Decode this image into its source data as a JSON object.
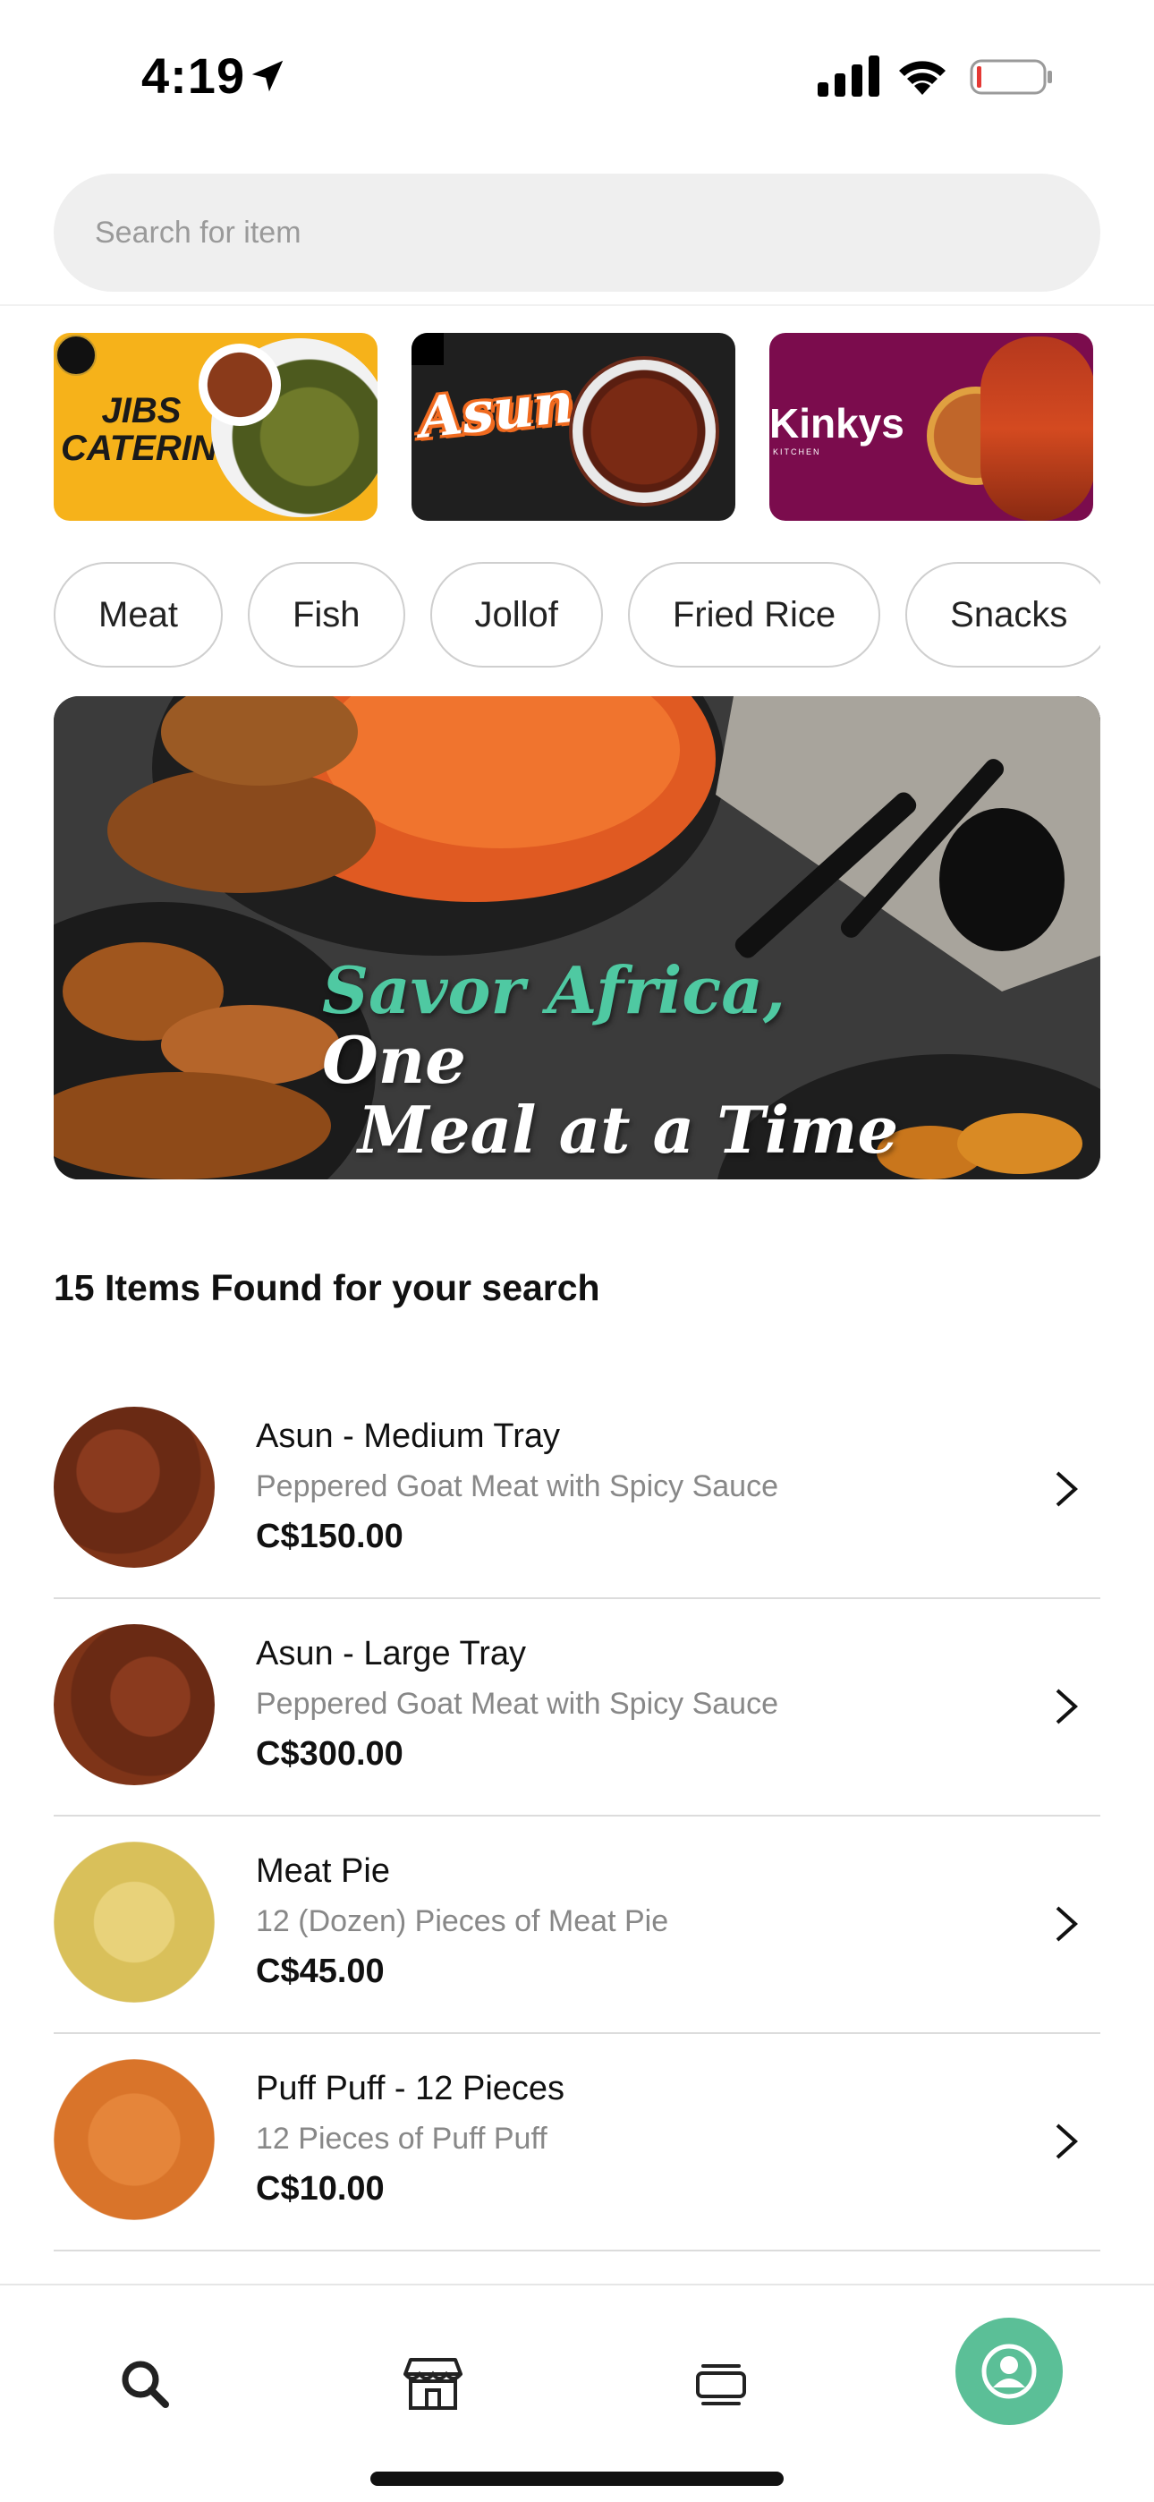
{
  "status_bar": {
    "time": "4:19"
  },
  "search": {
    "placeholder": "Search for item"
  },
  "vendors": [
    {
      "name": "JIBS CATERING",
      "icon": "vendor-jibs"
    },
    {
      "name": "Asun yyc",
      "icon": "vendor-asun"
    },
    {
      "name": "Kinkys",
      "subtitle": "KITCHEN",
      "icon": "vendor-kinkys"
    }
  ],
  "categories": [
    "Meat",
    "Fish",
    "Jollof",
    "Fried Rice",
    "Snacks"
  ],
  "hero": {
    "slogan_accent": "Savor Africa,",
    "slogan_rest": "One",
    "slogan_line2": "Meal at a Time"
  },
  "results": {
    "title": "15 Items Found for your search"
  },
  "items": [
    {
      "name": "Asun - Medium Tray",
      "description": "Peppered Goat Meat with Spicy Sauce",
      "price": "C$150.00"
    },
    {
      "name": "Asun - Large Tray",
      "description": "Peppered Goat Meat with Spicy Sauce",
      "price": "C$300.00"
    },
    {
      "name": "Meat Pie",
      "description": "12 (Dozen) Pieces of Meat Pie",
      "price": "C$45.00"
    },
    {
      "name": "Puff Puff - 12 Pieces",
      "description": "12 Pieces of Puff Puff",
      "price": "C$10.00"
    }
  ],
  "nav": {
    "items": [
      "search-icon",
      "store-icon",
      "orders-icon",
      "profile-icon"
    ],
    "active_color": "#5bbf97"
  },
  "colors": {
    "accent": "#4fc9a2",
    "jibs_bg": "#f6b21a",
    "asun_bg": "#1f1f1f",
    "kinkys_bg": "#7b0c4d"
  }
}
